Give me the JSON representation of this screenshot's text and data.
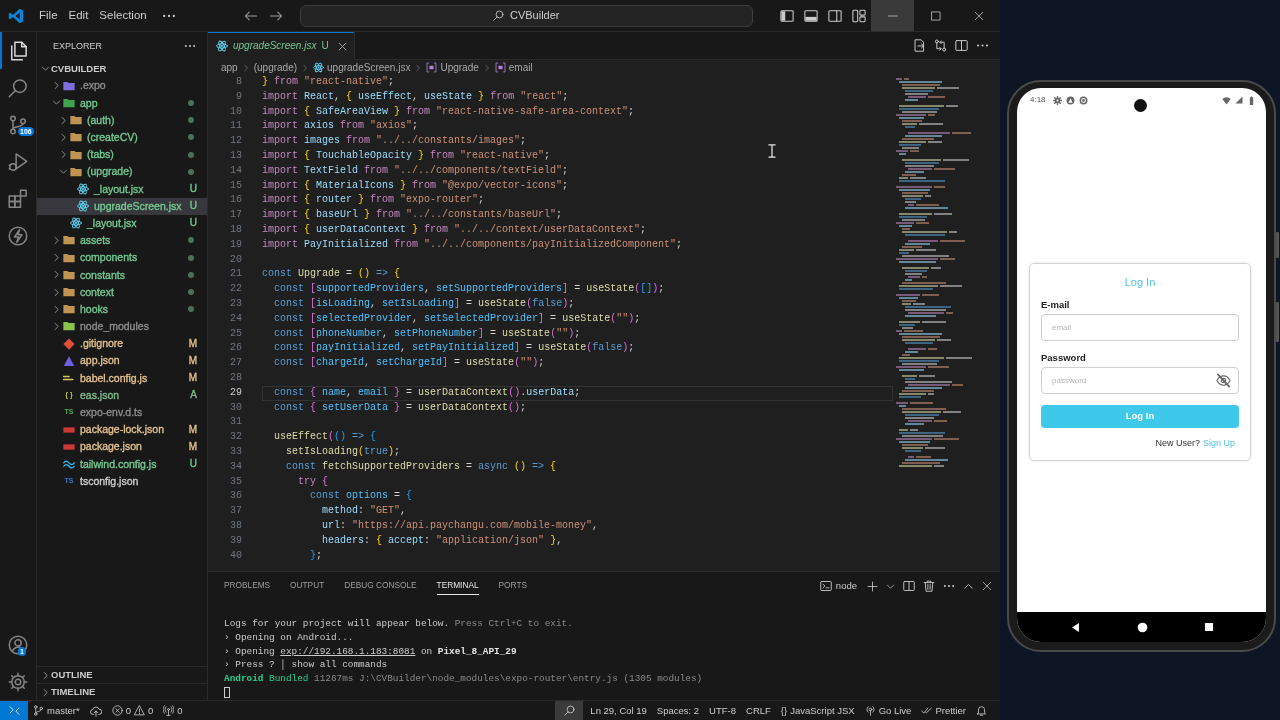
{
  "title_bar": {
    "menus": [
      "File",
      "Edit",
      "Selection"
    ],
    "search": "CVBuilder",
    "window_controls": [
      {
        "kind": "minimize",
        "hovered": true
      },
      {
        "kind": "maximize",
        "hovered": false
      },
      {
        "kind": "close",
        "hovered": false
      }
    ]
  },
  "activity_bar": {
    "items": [
      {
        "kind": "explorer",
        "selected": true
      },
      {
        "kind": "search",
        "selected": false
      },
      {
        "kind": "source-control",
        "selected": false,
        "badge": "106"
      },
      {
        "kind": "run-debug",
        "selected": false
      },
      {
        "kind": "extensions",
        "selected": false
      },
      {
        "kind": "lightning",
        "selected": false
      }
    ],
    "bottom": [
      {
        "kind": "accounts",
        "badge": "1"
      },
      {
        "kind": "settings"
      }
    ]
  },
  "sidebar": {
    "title": "EXPLORER",
    "root": {
      "name": "CVBUILDER",
      "expanded": true,
      "children": [
        {
          "name": ".expo",
          "kind": "expo-folder",
          "color": "#8c8c8c",
          "has_changes": false,
          "expanded": false,
          "selected": false
        },
        {
          "name": "app",
          "kind": "app-folder",
          "color": "#73c991",
          "has_changes": true,
          "expanded": true,
          "selected": false,
          "children": [
            {
              "name": "(auth)",
              "kind": "folder",
              "color": "#73c991",
              "has_changes": true,
              "expanded": false,
              "selected": false
            },
            {
              "name": "(createCV)",
              "kind": "folder",
              "color": "#73c991",
              "has_changes": true,
              "expanded": false,
              "selected": false
            },
            {
              "name": "(tabs)",
              "kind": "folder",
              "color": "#73c991",
              "has_changes": true,
              "expanded": false,
              "selected": false
            },
            {
              "name": "(upgrade)",
              "kind": "folder",
              "color": "#73c991",
              "has_changes": true,
              "expanded": true,
              "selected": false,
              "children": [
                {
                  "name": "_layout.jsx",
                  "kind": "jsx",
                  "color": "#73c991",
                  "badge": "U",
                  "selected": false
                },
                {
                  "name": "upgradeScreen.jsx",
                  "kind": "jsx",
                  "color": "#73c991",
                  "badge": "U",
                  "selected": true
                }
              ]
            },
            {
              "name": "_layout.jsx",
              "kind": "jsx",
              "color": "#73c991",
              "badge": "U",
              "selected": false
            }
          ]
        },
        {
          "name": "assets",
          "kind": "folder",
          "color": "#73c991",
          "has_changes": true,
          "expanded": false,
          "selected": false
        },
        {
          "name": "components",
          "kind": "folder",
          "color": "#73c991",
          "has_changes": true,
          "expanded": false,
          "selected": false
        },
        {
          "name": "constants",
          "kind": "folder",
          "color": "#73c991",
          "has_changes": true,
          "expanded": false,
          "selected": false
        },
        {
          "name": "context",
          "kind": "folder",
          "color": "#73c991",
          "has_changes": true,
          "expanded": false,
          "selected": false
        },
        {
          "name": "hooks",
          "kind": "folder",
          "color": "#73c991",
          "has_changes": true,
          "expanded": false,
          "selected": false
        },
        {
          "name": "node_modules",
          "kind": "node-folder",
          "color": "#8c8c8c",
          "has_changes": false,
          "expanded": false,
          "selected": false
        },
        {
          "name": ".gitignore",
          "kind": "git",
          "color": "#e2c08d",
          "badge": "M",
          "selected": false
        },
        {
          "name": "app.json",
          "kind": "app-config",
          "color": "#e2c08d",
          "badge": "M",
          "selected": false
        },
        {
          "name": "babel.config.js",
          "kind": "babel",
          "color": "#e2c08d",
          "badge": "M",
          "selected": false
        },
        {
          "name": "eas.json",
          "kind": "braces",
          "icon_text": "{ }",
          "color": "#81b88b",
          "badge": "A",
          "selected": false
        },
        {
          "name": "expo-env.d.ts",
          "kind": "ts-declaration",
          "icon_text": "TS",
          "color": "#8c8c8c",
          "selected": false
        },
        {
          "name": "package-lock.json",
          "kind": "npm",
          "color": "#e2c08d",
          "badge": "M",
          "selected": false
        },
        {
          "name": "package.json",
          "kind": "npm",
          "color": "#e2c08d",
          "badge": "M",
          "selected": false
        },
        {
          "name": "tailwind.config.js",
          "kind": "tailwind",
          "color": "#73c991",
          "badge": "U",
          "selected": false
        },
        {
          "name": "tsconfig.json",
          "kind": "tsconfig",
          "icon_text": "TS",
          "color": "#cccccc",
          "selected": false
        }
      ]
    },
    "sections": [
      {
        "title": "OUTLINE",
        "expanded": false
      },
      {
        "title": "TIMELINE",
        "expanded": false
      }
    ]
  },
  "editor": {
    "tabs": [
      {
        "kind": "jsx",
        "label": "upgradeScreen.jsx",
        "badge": "U",
        "color": "#73c991",
        "selected": true,
        "preview": true
      }
    ],
    "breadcrumbs": [
      {
        "kind": "folder",
        "text": "app"
      },
      {
        "kind": "folder",
        "text": "(upgrade)"
      },
      {
        "kind": "jsx",
        "text": "upgradeScreen.jsx"
      },
      {
        "kind": "symbol",
        "text": "Upgrade"
      },
      {
        "kind": "symbol",
        "text": "email"
      }
    ],
    "lines": [
      {
        "number": "8",
        "current": false,
        "tokens": [
          {
            "text": "} ",
            "kind": "bracket1"
          },
          {
            "text": "from ",
            "kind": "control"
          },
          {
            "text": "\"react-native\"",
            "kind": "string"
          },
          {
            "text": ";",
            "kind": "plain"
          }
        ]
      },
      {
        "number": "9",
        "current": false,
        "tokens": [
          {
            "text": "import ",
            "kind": "control"
          },
          {
            "text": "React",
            "kind": "variable"
          },
          {
            "text": ", ",
            "kind": "plain"
          },
          {
            "text": "{ ",
            "kind": "bracket1"
          },
          {
            "text": "useEffect",
            "kind": "variable"
          },
          {
            "text": ", ",
            "kind": "plain"
          },
          {
            "text": "useState ",
            "kind": "variable"
          },
          {
            "text": "} ",
            "kind": "bracket1"
          },
          {
            "text": "from ",
            "kind": "control"
          },
          {
            "text": "\"react\"",
            "kind": "string"
          },
          {
            "text": ";",
            "kind": "plain"
          }
        ]
      },
      {
        "number": "10",
        "current": false,
        "tokens": [
          {
            "text": "import ",
            "kind": "control"
          },
          {
            "text": "{ ",
            "kind": "bracket1"
          },
          {
            "text": "SafeAreaView ",
            "kind": "variable"
          },
          {
            "text": "} ",
            "kind": "bracket1"
          },
          {
            "text": "from ",
            "kind": "control"
          },
          {
            "text": "\"react-native-safe-area-context\"",
            "kind": "string"
          },
          {
            "text": ";",
            "kind": "plain"
          }
        ]
      },
      {
        "number": "11",
        "current": false,
        "tokens": [
          {
            "text": "import ",
            "kind": "control"
          },
          {
            "text": "axios ",
            "kind": "variable"
          },
          {
            "text": "from ",
            "kind": "control"
          },
          {
            "text": "\"axios\"",
            "kind": "string"
          },
          {
            "text": ";",
            "kind": "plain"
          }
        ]
      },
      {
        "number": "12",
        "current": false,
        "tokens": [
          {
            "text": "import ",
            "kind": "control"
          },
          {
            "text": "images ",
            "kind": "variable"
          },
          {
            "text": "from ",
            "kind": "control"
          },
          {
            "text": "\"../../constants/images\"",
            "kind": "string"
          },
          {
            "text": ";",
            "kind": "plain"
          }
        ]
      },
      {
        "number": "13",
        "current": false,
        "tokens": [
          {
            "text": "import ",
            "kind": "control"
          },
          {
            "text": "{ ",
            "kind": "bracket1"
          },
          {
            "text": "TouchableOpacity ",
            "kind": "variable"
          },
          {
            "text": "} ",
            "kind": "bracket1"
          },
          {
            "text": "from ",
            "kind": "control"
          },
          {
            "text": "\"react-native\"",
            "kind": "string"
          },
          {
            "text": ";",
            "kind": "plain"
          }
        ]
      },
      {
        "number": "14",
        "current": false,
        "tokens": [
          {
            "text": "import ",
            "kind": "control"
          },
          {
            "text": "TextField ",
            "kind": "variable"
          },
          {
            "text": "from ",
            "kind": "control"
          },
          {
            "text": "\"../../components/textField\"",
            "kind": "string"
          },
          {
            "text": ";",
            "kind": "plain"
          }
        ]
      },
      {
        "number": "15",
        "current": false,
        "tokens": [
          {
            "text": "import ",
            "kind": "control"
          },
          {
            "text": "{ ",
            "kind": "bracket1"
          },
          {
            "text": "MaterialIcons ",
            "kind": "variable"
          },
          {
            "text": "} ",
            "kind": "bracket1"
          },
          {
            "text": "from ",
            "kind": "control"
          },
          {
            "text": "\"@expo/vector-icons\"",
            "kind": "string"
          },
          {
            "text": ";",
            "kind": "plain"
          }
        ]
      },
      {
        "number": "16",
        "current": false,
        "tokens": [
          {
            "text": "import ",
            "kind": "control"
          },
          {
            "text": "{ ",
            "kind": "bracket1"
          },
          {
            "text": "router ",
            "kind": "variable"
          },
          {
            "text": "} ",
            "kind": "bracket1"
          },
          {
            "text": "from ",
            "kind": "control"
          },
          {
            "text": "\"expo-router\"",
            "kind": "string"
          },
          {
            "text": ";",
            "kind": "plain"
          }
        ]
      },
      {
        "number": "17",
        "current": false,
        "tokens": [
          {
            "text": "import ",
            "kind": "control"
          },
          {
            "text": "{ ",
            "kind": "bracket1"
          },
          {
            "text": "baseUrl ",
            "kind": "variable"
          },
          {
            "text": "} ",
            "kind": "bracket1"
          },
          {
            "text": "from ",
            "kind": "control"
          },
          {
            "text": "\"../../constants/baseUrl\"",
            "kind": "string"
          },
          {
            "text": ";",
            "kind": "plain"
          }
        ]
      },
      {
        "number": "18",
        "current": false,
        "tokens": [
          {
            "text": "import ",
            "kind": "control"
          },
          {
            "text": "{ ",
            "kind": "bracket1"
          },
          {
            "text": "userDataContext ",
            "kind": "variable"
          },
          {
            "text": "} ",
            "kind": "bracket1"
          },
          {
            "text": "from ",
            "kind": "control"
          },
          {
            "text": "\"../../context/userDataContext\"",
            "kind": "string"
          },
          {
            "text": ";",
            "kind": "plain"
          }
        ]
      },
      {
        "number": "19",
        "current": false,
        "tokens": [
          {
            "text": "import ",
            "kind": "control"
          },
          {
            "text": "PayInitialized ",
            "kind": "variable"
          },
          {
            "text": "from ",
            "kind": "control"
          },
          {
            "text": "\"../../components/payInitializedComponent\"",
            "kind": "string"
          },
          {
            "text": ";",
            "kind": "plain"
          }
        ]
      },
      {
        "number": "20",
        "current": false
      },
      {
        "number": "21",
        "current": false,
        "tokens": [
          {
            "text": "const ",
            "kind": "keyword"
          },
          {
            "text": "Upgrade",
            "kind": "function"
          },
          {
            "text": " = ",
            "kind": "plain"
          },
          {
            "text": "() ",
            "kind": "bracket1"
          },
          {
            "text": "=> ",
            "kind": "keyword"
          },
          {
            "text": "{",
            "kind": "bracket1"
          }
        ]
      },
      {
        "number": "22",
        "current": false,
        "tokens": [
          {
            "text": "  const ",
            "kind": "keyword"
          },
          {
            "text": "[",
            "kind": "bracket2"
          },
          {
            "text": "supportedProviders",
            "kind": "constant"
          },
          {
            "text": ", ",
            "kind": "plain"
          },
          {
            "text": "setSupportedProviders",
            "kind": "constant"
          },
          {
            "text": "]",
            "kind": "bracket2"
          },
          {
            "text": " = ",
            "kind": "plain"
          },
          {
            "text": "useState",
            "kind": "function"
          },
          {
            "text": "(",
            "kind": "bracket2"
          },
          {
            "text": "[]",
            "kind": "bracket3"
          },
          {
            "text": ")",
            "kind": "bracket2"
          },
          {
            "text": ";",
            "kind": "plain"
          }
        ]
      },
      {
        "number": "23",
        "current": false,
        "tokens": [
          {
            "text": "  const ",
            "kind": "keyword"
          },
          {
            "text": "[",
            "kind": "bracket2"
          },
          {
            "text": "isLoading",
            "kind": "constant"
          },
          {
            "text": ", ",
            "kind": "plain"
          },
          {
            "text": "setIsLoading",
            "kind": "constant"
          },
          {
            "text": "]",
            "kind": "bracket2"
          },
          {
            "text": " = ",
            "kind": "plain"
          },
          {
            "text": "useState",
            "kind": "function"
          },
          {
            "text": "(",
            "kind": "bracket2"
          },
          {
            "text": "false",
            "kind": "keyword"
          },
          {
            "text": ")",
            "kind": "bracket2"
          },
          {
            "text": ";",
            "kind": "plain"
          }
        ]
      },
      {
        "number": "24",
        "current": false,
        "tokens": [
          {
            "text": "  const ",
            "kind": "keyword"
          },
          {
            "text": "[",
            "kind": "bracket2"
          },
          {
            "text": "selectedProvider",
            "kind": "constant"
          },
          {
            "text": ", ",
            "kind": "plain"
          },
          {
            "text": "setSelectedProvider",
            "kind": "constant"
          },
          {
            "text": "]",
            "kind": "bracket2"
          },
          {
            "text": " = ",
            "kind": "plain"
          },
          {
            "text": "useState",
            "kind": "function"
          },
          {
            "text": "(",
            "kind": "bracket2"
          },
          {
            "text": "\"\"",
            "kind": "string"
          },
          {
            "text": ")",
            "kind": "bracket2"
          },
          {
            "text": ";",
            "kind": "plain"
          }
        ]
      },
      {
        "number": "25",
        "current": false,
        "tokens": [
          {
            "text": "  const ",
            "kind": "keyword"
          },
          {
            "text": "[",
            "kind": "bracket2"
          },
          {
            "text": "phoneNumber",
            "kind": "constant"
          },
          {
            "text": ", ",
            "kind": "plain"
          },
          {
            "text": "setPhoneNumber",
            "kind": "constant"
          },
          {
            "text": "]",
            "kind": "bracket2"
          },
          {
            "text": " = ",
            "kind": "plain"
          },
          {
            "text": "useState",
            "kind": "function"
          },
          {
            "text": "(",
            "kind": "bracket2"
          },
          {
            "text": "\"\"",
            "kind": "string"
          },
          {
            "text": ")",
            "kind": "bracket2"
          },
          {
            "text": ";",
            "kind": "plain"
          }
        ]
      },
      {
        "number": "26",
        "current": false,
        "tokens": [
          {
            "text": "  const ",
            "kind": "keyword"
          },
          {
            "text": "[",
            "kind": "bracket2"
          },
          {
            "text": "payInitialized",
            "kind": "constant"
          },
          {
            "text": ", ",
            "kind": "plain"
          },
          {
            "text": "setPayInitialized",
            "kind": "constant"
          },
          {
            "text": "]",
            "kind": "bracket2"
          },
          {
            "text": " = ",
            "kind": "plain"
          },
          {
            "text": "useState",
            "kind": "function"
          },
          {
            "text": "(",
            "kind": "bracket2"
          },
          {
            "text": "false",
            "kind": "keyword"
          },
          {
            "text": ")",
            "kind": "bracket2"
          },
          {
            "text": ";",
            "kind": "plain"
          }
        ]
      },
      {
        "number": "27",
        "current": false,
        "tokens": [
          {
            "text": "  const ",
            "kind": "keyword"
          },
          {
            "text": "[",
            "kind": "bracket2"
          },
          {
            "text": "chargeId",
            "kind": "constant"
          },
          {
            "text": ", ",
            "kind": "plain"
          },
          {
            "text": "setChargeId",
            "kind": "constant"
          },
          {
            "text": "]",
            "kind": "bracket2"
          },
          {
            "text": " = ",
            "kind": "plain"
          },
          {
            "text": "useState",
            "kind": "function"
          },
          {
            "text": "(",
            "kind": "bracket2"
          },
          {
            "text": "\"\"",
            "kind": "string"
          },
          {
            "text": ")",
            "kind": "bracket2"
          },
          {
            "text": ";",
            "kind": "plain"
          }
        ]
      },
      {
        "number": "28",
        "current": false
      },
      {
        "number": "29",
        "current": true,
        "tokens": [
          {
            "text": "  const ",
            "kind": "keyword"
          },
          {
            "text": "{ ",
            "kind": "bracket2"
          },
          {
            "text": "name",
            "kind": "constant"
          },
          {
            "text": ", ",
            "kind": "plain"
          },
          {
            "text": "email ",
            "kind": "constant"
          },
          {
            "text": "} ",
            "kind": "bracket2"
          },
          {
            "text": "= ",
            "kind": "plain"
          },
          {
            "text": "userDataContext",
            "kind": "function"
          },
          {
            "text": "()",
            "kind": "bracket2"
          },
          {
            "text": ".",
            "kind": "plain"
          },
          {
            "text": "userData",
            "kind": "variable"
          },
          {
            "text": ";",
            "kind": "plain"
          }
        ]
      },
      {
        "number": "30",
        "current": false,
        "tokens": [
          {
            "text": "  const ",
            "kind": "keyword"
          },
          {
            "text": "{ ",
            "kind": "bracket2"
          },
          {
            "text": "setUserData ",
            "kind": "constant"
          },
          {
            "text": "} ",
            "kind": "bracket2"
          },
          {
            "text": "= ",
            "kind": "plain"
          },
          {
            "text": "userDataContext",
            "kind": "function"
          },
          {
            "text": "()",
            "kind": "bracket2"
          },
          {
            "text": ";",
            "kind": "plain"
          }
        ]
      },
      {
        "number": "31",
        "current": false
      },
      {
        "number": "32",
        "current": false,
        "tokens": [
          {
            "text": "  useEffect",
            "kind": "function"
          },
          {
            "text": "(",
            "kind": "bracket2"
          },
          {
            "text": "() ",
            "kind": "bracket3"
          },
          {
            "text": "=> ",
            "kind": "keyword"
          },
          {
            "text": "{",
            "kind": "bracket3"
          }
        ]
      },
      {
        "number": "33",
        "current": false,
        "tokens": [
          {
            "text": "    setIsLoading",
            "kind": "function"
          },
          {
            "text": "(",
            "kind": "bracket1"
          },
          {
            "text": "true",
            "kind": "keyword"
          },
          {
            "text": ")",
            "kind": "bracket1"
          },
          {
            "text": ";",
            "kind": "plain"
          }
        ]
      },
      {
        "number": "34",
        "current": false,
        "tokens": [
          {
            "text": "    const ",
            "kind": "keyword"
          },
          {
            "text": "fetchSupportedProviders",
            "kind": "function"
          },
          {
            "text": " = ",
            "kind": "plain"
          },
          {
            "text": "async ",
            "kind": "keyword"
          },
          {
            "text": "() ",
            "kind": "bracket1"
          },
          {
            "text": "=> ",
            "kind": "keyword"
          },
          {
            "text": "{",
            "kind": "bracket1"
          }
        ]
      },
      {
        "number": "35",
        "current": false,
        "tokens": [
          {
            "text": "      try ",
            "kind": "control"
          },
          {
            "text": "{",
            "kind": "bracket2"
          }
        ]
      },
      {
        "number": "36",
        "current": false,
        "tokens": [
          {
            "text": "        const ",
            "kind": "keyword"
          },
          {
            "text": "options",
            "kind": "constant"
          },
          {
            "text": " = ",
            "kind": "plain"
          },
          {
            "text": "{",
            "kind": "bracket3"
          }
        ]
      },
      {
        "number": "37",
        "current": false,
        "tokens": [
          {
            "text": "          method",
            "kind": "variable"
          },
          {
            "text": ": ",
            "kind": "plain"
          },
          {
            "text": "\"GET\"",
            "kind": "string"
          },
          {
            "text": ",",
            "kind": "plain"
          }
        ]
      },
      {
        "number": "38",
        "current": false,
        "tokens": [
          {
            "text": "          url",
            "kind": "variable"
          },
          {
            "text": ": ",
            "kind": "plain"
          },
          {
            "text": "\"https://api.paychangu.com/mobile-money\"",
            "kind": "string"
          },
          {
            "text": ",",
            "kind": "plain"
          }
        ]
      },
      {
        "number": "39",
        "current": false,
        "tokens": [
          {
            "text": "          headers",
            "kind": "variable"
          },
          {
            "text": ": ",
            "kind": "plain"
          },
          {
            "text": "{ ",
            "kind": "bracket1"
          },
          {
            "text": "accept",
            "kind": "variable"
          },
          {
            "text": ": ",
            "kind": "plain"
          },
          {
            "text": "\"application/json\" ",
            "kind": "string"
          },
          {
            "text": "}",
            "kind": "bracket1"
          },
          {
            "text": ",",
            "kind": "plain"
          }
        ]
      },
      {
        "number": "40",
        "current": false,
        "tokens": [
          {
            "text": "        }",
            "kind": "bracket3"
          },
          {
            "text": ";",
            "kind": "plain"
          }
        ]
      }
    ]
  },
  "panel": {
    "tabs": [
      {
        "label": "PROBLEMS",
        "selected": false
      },
      {
        "label": "OUTPUT",
        "selected": false
      },
      {
        "label": "DEBUG CONSOLE",
        "selected": false
      },
      {
        "label": "TERMINAL",
        "selected": true
      },
      {
        "label": "PORTS",
        "selected": false
      }
    ],
    "terminal": {
      "name": "node",
      "lines": [
        {
          "segments": [
            {
              "text": "Logs for your project will appear below.",
              "kind": "plain"
            },
            {
              "text": " Press Ctrl+C to exit.",
              "kind": "dim"
            }
          ]
        },
        {
          "segments": [
            {
              "text": "› Opening on Android...",
              "kind": "plain"
            }
          ]
        },
        {
          "segments": [
            {
              "text": "› Opening ",
              "kind": "plain"
            },
            {
              "text": "exp://192.168.1.183:8081",
              "kind": "link"
            },
            {
              "text": " on ",
              "kind": "plain"
            },
            {
              "text": "Pixel_8_API_29",
              "kind": "bold"
            }
          ]
        },
        {
          "segments": [
            {
              "text": "› Press ? │ show all commands",
              "kind": "plain"
            }
          ]
        },
        {
          "segments": [
            {
              "text": "Android",
              "kind": "success-bold"
            },
            {
              "text": " Bundled",
              "kind": "success"
            },
            {
              "text": " 11267ms J:\\CVBuilder\\node_modules\\expo-router\\entry.js (1305 modules)",
              "kind": "dim"
            }
          ]
        }
      ]
    }
  },
  "status_bar": {
    "left": [
      {
        "kind": "remote"
      },
      {
        "kind": "branch",
        "text": "master*"
      },
      {
        "kind": "sync"
      },
      {
        "kind": "problems",
        "errors": "0",
        "warnings": "0"
      },
      {
        "kind": "ports",
        "text": "0"
      }
    ],
    "zoom_button": {
      "hovered": true
    },
    "right": [
      {
        "kind": "text",
        "text": "Ln 29, Col 19"
      },
      {
        "kind": "text",
        "text": "Spaces: 2"
      },
      {
        "kind": "text",
        "text": "UTF-8"
      },
      {
        "kind": "text",
        "text": "CRLF"
      },
      {
        "kind": "language",
        "icon_text": "{}",
        "text": "JavaScript JSX"
      },
      {
        "kind": "golive",
        "text": "Go Live"
      },
      {
        "kind": "prettier",
        "text": "Prettier"
      },
      {
        "kind": "bell"
      }
    ]
  },
  "emulator": {
    "status_bar": {
      "time": "4:18"
    },
    "login": {
      "title": "Log In",
      "fields": [
        {
          "kind": "email",
          "label": "E-mail",
          "placeholder": "email"
        },
        {
          "kind": "password",
          "label": "Password",
          "placeholder": "password"
        }
      ],
      "button": "Log In",
      "prompt": "New User?",
      "link": "Sign Up"
    }
  }
}
